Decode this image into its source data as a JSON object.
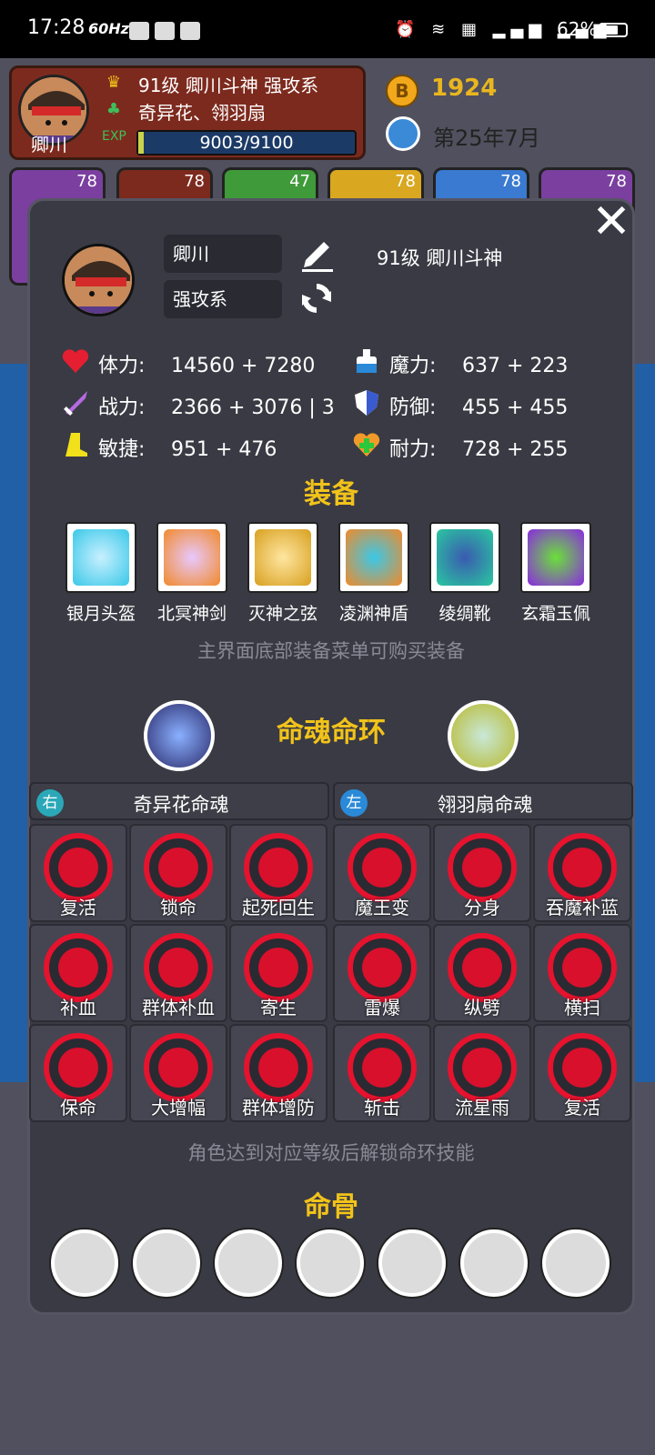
{
  "status": {
    "time": "17:28",
    "hz": "60Hz",
    "battery": "62%"
  },
  "header": {
    "name": "卿川",
    "level_title": "91级 卿川斗神 强攻系",
    "souls": "奇异花、翎羽扇",
    "exp": "9003/9100",
    "exp_progress": 0.989,
    "coins": "1924",
    "date": "第25年7月",
    "team_levels": [
      "78",
      "78",
      "47",
      "78",
      "78",
      "78"
    ]
  },
  "panel": {
    "name_field": "卿川",
    "type_field": "强攻系",
    "title": "91级 卿川斗神",
    "stats": [
      {
        "label": "体力:",
        "value": "14560 + 7280",
        "icon": "heart-icon"
      },
      {
        "label": "魔力:",
        "value": "637 + 223",
        "icon": "potion-icon"
      },
      {
        "label": "战力:",
        "value": "2366 + 3076 | 3",
        "icon": "sword-icon"
      },
      {
        "label": "防御:",
        "value": "455 + 455",
        "icon": "shield-icon"
      },
      {
        "label": "敏捷:",
        "value": "951 + 476",
        "icon": "boot-icon"
      },
      {
        "label": "耐力:",
        "value": "728 + 255",
        "icon": "health-heart-icon"
      }
    ],
    "equip_title": "装备",
    "equipment": [
      "银月头盔",
      "北冥神剑",
      "灭神之弦",
      "凌渊神盾",
      "绫绸靴",
      "玄霜玉佩"
    ],
    "equip_hint": "主界面底部装备菜单可购买装备",
    "ring_title": "命魂命环",
    "right_soul": {
      "badge": "右",
      "name": "奇异花命魂"
    },
    "left_soul": {
      "badge": "左",
      "name": "翎羽扇命魂"
    },
    "right_skills": [
      "复活",
      "锁命",
      "起死回生",
      "补血",
      "群体补血",
      "寄生",
      "保命",
      "大增幅",
      "群体增防"
    ],
    "left_skills": [
      "魔王变",
      "分身",
      "吞魔补蓝",
      "雷爆",
      "纵劈",
      "横扫",
      "斩击",
      "流星雨",
      "复活"
    ],
    "skill_hint": "角色达到对应等级后解锁命环技能",
    "bone_title": "命骨"
  },
  "colors": {
    "accent": "#f1c31a",
    "panel": "#3a3a44",
    "skill_red": "#e6122e"
  }
}
